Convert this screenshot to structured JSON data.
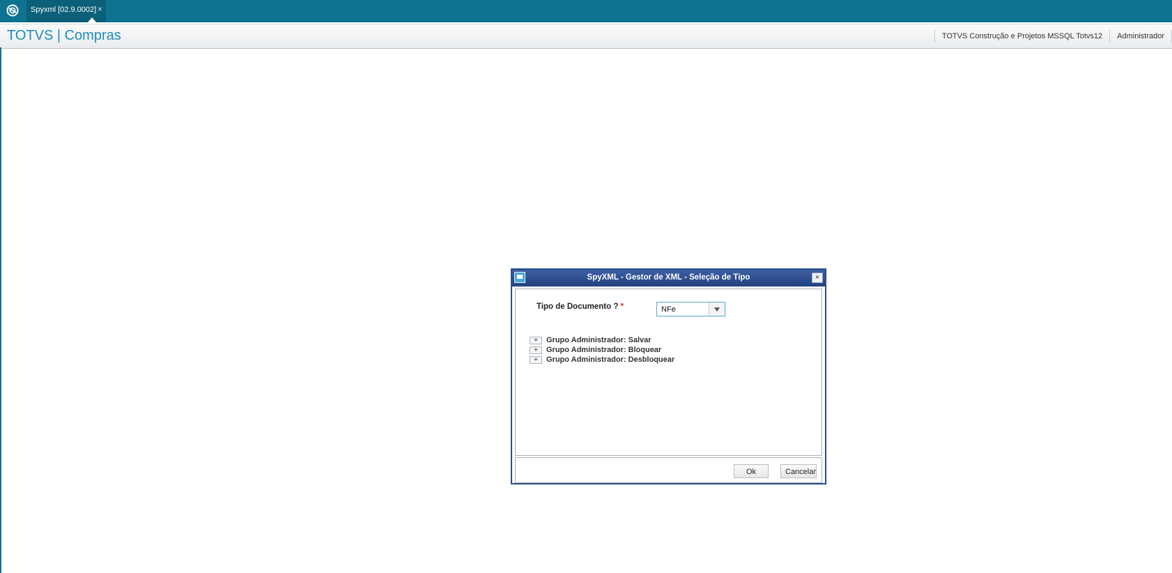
{
  "topbar": {
    "tab_label": "Spyxml [02.9.0002]",
    "tab_close": "×"
  },
  "header": {
    "title": "TOTVS | Compras",
    "environment": "TOTVS Construção e Projetos MSSQL Totvs12",
    "user": "Administrador"
  },
  "dialog": {
    "title": "SpyXML - Gestor de XML - Seleção de Tipo",
    "close_glyph": "×",
    "field_label": "Tipo de Documento ?",
    "required_mark": "*",
    "select_value": "NFe",
    "tree_items": [
      {
        "expander": "+",
        "label": "Grupo Administrador: Salvar"
      },
      {
        "expander": "+",
        "label": "Grupo Administrador: Bloquear"
      },
      {
        "expander": "+",
        "label": "Grupo Administrador: Desbloquear"
      }
    ],
    "ok_label": "Ok",
    "cancel_label": "Cancelar"
  },
  "colors": {
    "topbar": "#0e7390",
    "brand_title": "#1d8bb8",
    "dialog_titlebar": "#2a4d8a"
  }
}
